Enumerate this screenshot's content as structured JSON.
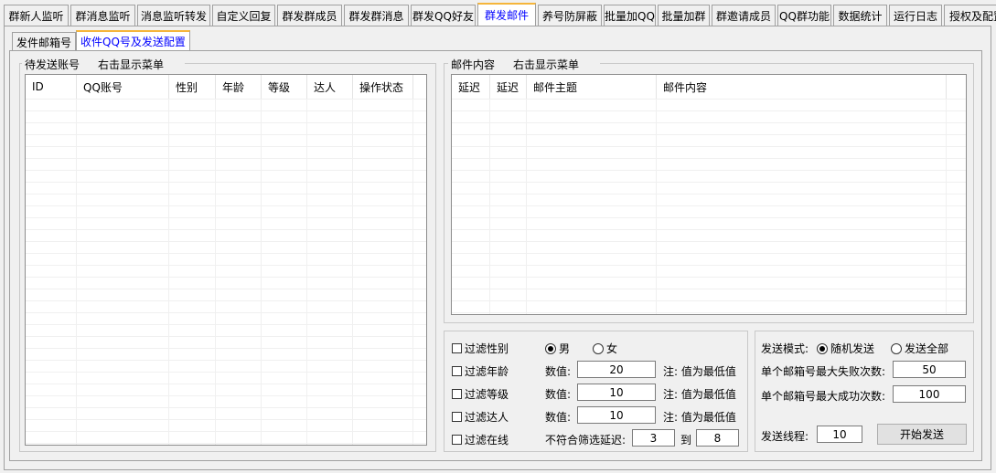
{
  "tabs": [
    "群新人监听",
    "群消息监听",
    "消息监听转发",
    "自定义回复",
    "群发群成员",
    "群发群消息",
    "群发QQ好友",
    "群发邮件",
    "养号防屏蔽",
    "批量加QQ",
    "批量加群",
    "群邀请成员",
    "QQ群功能",
    "数据统计",
    "运行日志",
    "授权及配置"
  ],
  "active_tab": "群发邮件",
  "subtabs": [
    "发件邮箱号",
    "收件QQ号及发送配置"
  ],
  "active_subtab": "收件QQ号及发送配置",
  "left_group": {
    "title": "待发送账号",
    "hint": "右击显示菜单",
    "columns": [
      "ID",
      "QQ账号",
      "性别",
      "年龄",
      "等级",
      "达人",
      "操作状态"
    ]
  },
  "right_group": {
    "title": "邮件内容",
    "hint": "右击显示菜单",
    "columns": [
      "延迟",
      "延迟",
      "邮件主题",
      "邮件内容"
    ]
  },
  "filters": {
    "gender": {
      "label": "过滤性别",
      "male": "男",
      "female": "女"
    },
    "age": {
      "label": "过滤年龄",
      "value_label": "数值:",
      "value": "20",
      "note": "注: 值为最低值"
    },
    "level": {
      "label": "过滤等级",
      "value_label": "数值:",
      "value": "10",
      "note": "注: 值为最低值"
    },
    "talent": {
      "label": "过滤达人",
      "value_label": "数值:",
      "value": "10",
      "note": "注: 值为最低值"
    },
    "online": {
      "label": "过滤在线",
      "delay_label": "不符合筛选延迟:",
      "delay_from": "3",
      "to_label": "到",
      "delay_to": "8"
    }
  },
  "send": {
    "mode_label": "发送模式:",
    "mode_random": "随机发送",
    "mode_all": "发送全部",
    "max_fail_label": "单个邮箱号最大失败次数:",
    "max_fail": "50",
    "max_success_label": "单个邮箱号最大成功次数:",
    "max_success": "100",
    "threads_label": "发送线程:",
    "threads": "10",
    "start_button": "开始发送"
  }
}
